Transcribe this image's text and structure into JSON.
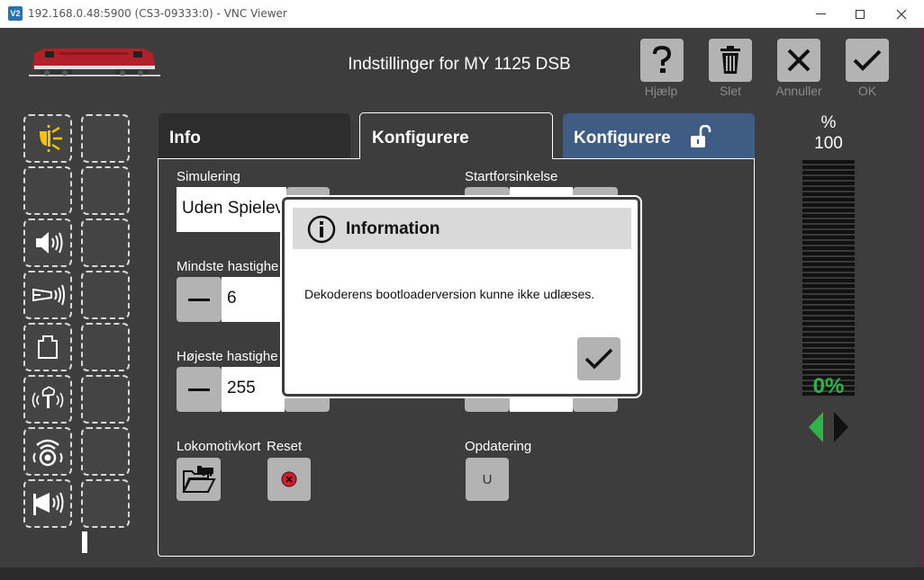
{
  "window": {
    "title": "192.168.0.48:5900 (CS3-09333:0) - VNC Viewer",
    "logo_text": "V2"
  },
  "header": {
    "title": "Indstillinger for MY 1125 DSB",
    "buttons": [
      {
        "label": "Hjælp",
        "icon": "question-icon"
      },
      {
        "label": "Slet",
        "icon": "trash-icon"
      },
      {
        "label": "Annuller",
        "icon": "close-icon"
      },
      {
        "label": "OK",
        "icon": "check-icon"
      }
    ]
  },
  "functions": {
    "icons": [
      "light-icon",
      "empty",
      "sound-icon",
      "horn-icon",
      "weight-icon",
      "smoke-icon",
      "signal-icon",
      "announcement-icon"
    ],
    "accent_light": "#f5c400"
  },
  "tabs": [
    {
      "label": "Info"
    },
    {
      "label": "Konfigurere"
    },
    {
      "label": "Konfigurere",
      "icon": "unlock-icon"
    }
  ],
  "settings": {
    "simulering_label": "Simulering",
    "simulering_value": "Uden Spielev",
    "startforsinkelse_label": "Startforsinkelse",
    "min_speed_label": "Mindste hastighe",
    "min_speed_value": "6",
    "max_speed_label": "Højeste hastighe",
    "max_speed_value": "255",
    "lokomotivkort_label": "Lokomotivkort",
    "reset_label": "Reset",
    "opdatering_label": "Opdatering",
    "opdatering_button": "U"
  },
  "speed": {
    "unit": "%",
    "max": "100",
    "current": "0%",
    "current_fraction": 0,
    "color_current": "#2fb24a"
  },
  "dialog": {
    "title": "Information",
    "message": "Dekoderens bootloaderversion kunne ikke udlæses."
  }
}
